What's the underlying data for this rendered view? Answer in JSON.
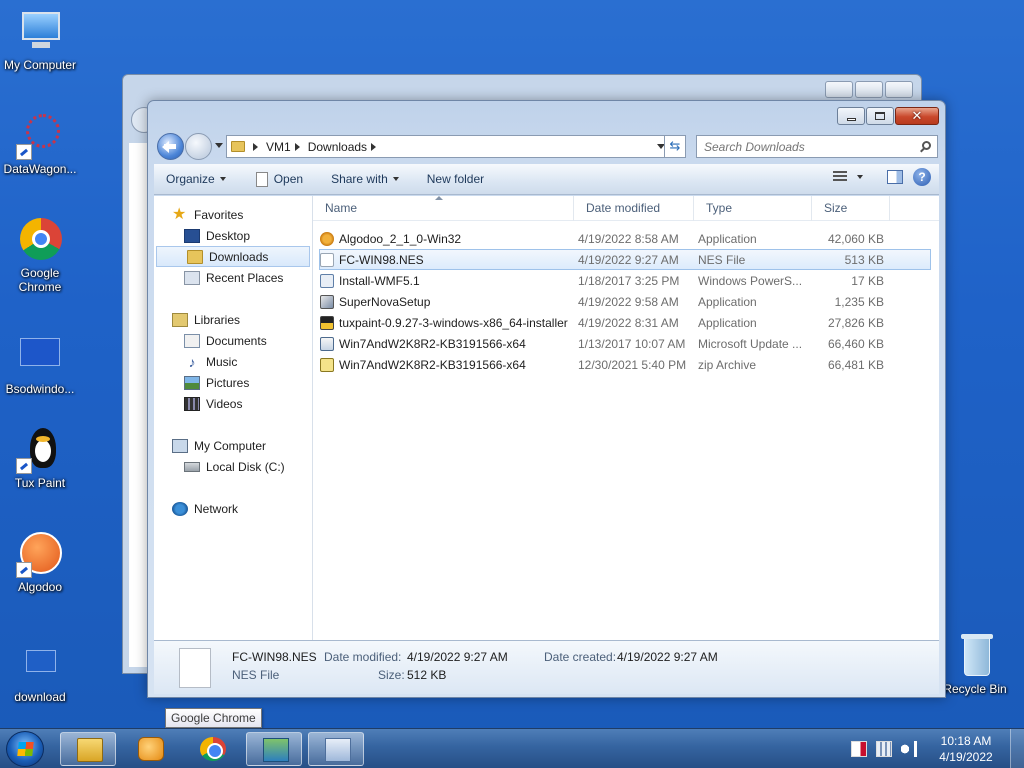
{
  "desktop": {
    "icons": [
      {
        "label": "My Computer"
      },
      {
        "label": "DataWagon..."
      },
      {
        "label": "Google Chrome"
      },
      {
        "label": "Bsodwindo..."
      },
      {
        "label": "Tux Paint"
      },
      {
        "label": "Algodoo"
      },
      {
        "label": "download"
      },
      {
        "label": "Recycle Bin"
      }
    ]
  },
  "window": {
    "address": {
      "segments": [
        "VM1",
        "Downloads"
      ]
    },
    "search": {
      "placeholder": "Search Downloads"
    },
    "toolbar": {
      "organize": "Organize",
      "open": "Open",
      "share_with": "Share with",
      "new_folder": "New folder"
    },
    "nav": {
      "favorites": "Favorites",
      "desktop": "Desktop",
      "downloads": "Downloads",
      "recent_places": "Recent Places",
      "libraries": "Libraries",
      "documents": "Documents",
      "music": "Music",
      "pictures": "Pictures",
      "videos": "Videos",
      "my_computer": "My Computer",
      "local_disk": "Local Disk (C:)",
      "network": "Network"
    },
    "columns": {
      "name": "Name",
      "date_modified": "Date modified",
      "type": "Type",
      "size": "Size"
    },
    "files": [
      {
        "name": "Algodoo_2_1_0-Win32",
        "date": "4/19/2022 8:58 AM",
        "type": "Application",
        "size": "42,060 KB",
        "icon": "algodoo-icon"
      },
      {
        "name": "FC-WIN98.NES",
        "date": "4/19/2022 9:27 AM",
        "type": "NES File",
        "size": "513 KB",
        "icon": "blank-file-icon"
      },
      {
        "name": "Install-WMF5.1",
        "date": "1/18/2017 3:25 PM",
        "type": "Windows PowerS...",
        "size": "17 KB",
        "icon": "powershell-script-icon"
      },
      {
        "name": "SuperNovaSetup",
        "date": "4/19/2022 9:58 AM",
        "type": "Application",
        "size": "1,235 KB",
        "icon": "supernova-icon"
      },
      {
        "name": "tuxpaint-0.9.27-3-windows-x86_64-installer",
        "date": "4/19/2022 8:31 AM",
        "type": "Application",
        "size": "27,826 KB",
        "icon": "tuxpaint-icon"
      },
      {
        "name": "Win7AndW2K8R2-KB3191566-x64",
        "date": "1/13/2017 10:07 AM",
        "type": "Microsoft Update ...",
        "size": "66,460 KB",
        "icon": "update-package-icon"
      },
      {
        "name": "Win7AndW2K8R2-KB3191566-x64",
        "date": "12/30/2021 5:40 PM",
        "type": "zip Archive",
        "size": "66,481 KB",
        "icon": "zip-archive-icon"
      }
    ],
    "details": {
      "name": "FC-WIN98.NES",
      "type": "NES File",
      "date_modified_label": "Date modified:",
      "date_modified": "4/19/2022 9:27 AM",
      "size_label": "Size:",
      "size": "512 KB",
      "date_created_label": "Date created:",
      "date_created": "4/19/2022 9:27 AM"
    }
  },
  "tooltip": "Google Chrome",
  "taskbar": {
    "time": "10:18 AM",
    "date": "4/19/2022"
  }
}
